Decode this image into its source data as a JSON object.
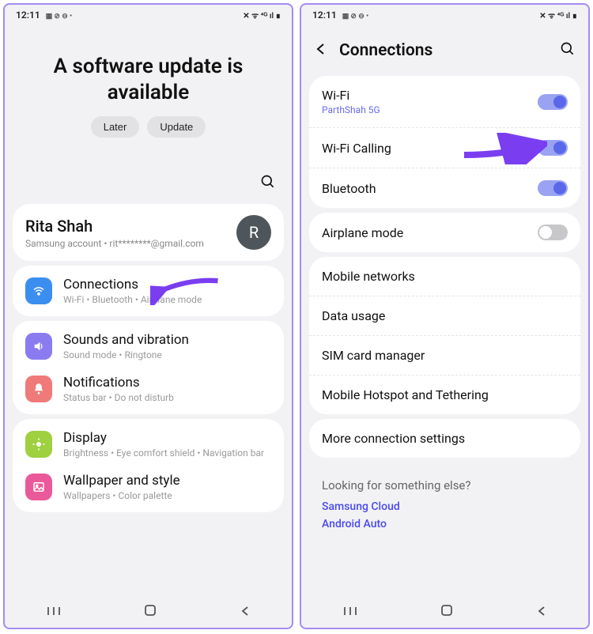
{
  "status": {
    "time": "12:11",
    "left_icons": "▦ ⊘ ⊖ •",
    "right_icons": "✕ ᯤ ⁴ᴳ ıl ∎"
  },
  "screen1": {
    "banner_line1": "A software update is",
    "banner_line2": "available",
    "later": "Later",
    "update": "Update",
    "profile": {
      "name": "Rita Shah",
      "sub": "Samsung account  •  rit********@gmail.com",
      "initial": "R"
    },
    "rows": {
      "connections": {
        "title": "Connections",
        "sub": "Wi-Fi  •  Bluetooth  •  Airplane mode"
      },
      "sounds": {
        "title": "Sounds and vibration",
        "sub": "Sound mode  •  Ringtone"
      },
      "notifications": {
        "title": "Notifications",
        "sub": "Status bar  •  Do not disturb"
      },
      "display": {
        "title": "Display",
        "sub": "Brightness  •  Eye comfort shield  •  Navigation bar"
      },
      "wallpaper": {
        "title": "Wallpaper and style",
        "sub": "Wallpapers  •  Color palette"
      }
    }
  },
  "screen2": {
    "title": "Connections",
    "items": {
      "wifi": {
        "title": "Wi-Fi",
        "sub": "ParthShah 5G"
      },
      "wificalling": {
        "title": "Wi-Fi Calling"
      },
      "bluetooth": {
        "title": "Bluetooth"
      },
      "airplane": {
        "title": "Airplane mode"
      },
      "mobile": {
        "title": "Mobile networks"
      },
      "data": {
        "title": "Data usage"
      },
      "sim": {
        "title": "SIM card manager"
      },
      "hotspot": {
        "title": "Mobile Hotspot and Tethering"
      },
      "more": {
        "title": "More connection settings"
      }
    },
    "footer": {
      "heading": "Looking for something else?",
      "link1": "Samsung Cloud",
      "link2": "Android Auto"
    }
  }
}
